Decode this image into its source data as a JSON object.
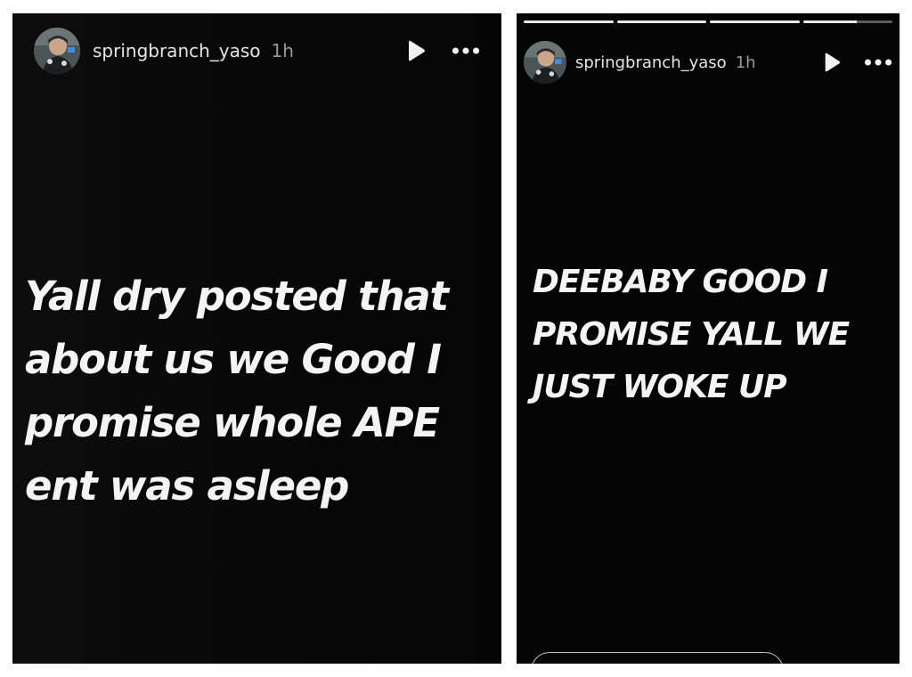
{
  "stories": [
    {
      "username": "springbranch_yaso",
      "time": "1h",
      "text": "Yall dry posted that\nabout us we Good I\npromise whole APE\nent was asleep",
      "avatar_icon": "profile-avatar",
      "play_icon": "play-icon",
      "more_icon": "more-options-icon"
    },
    {
      "username": "springbranch_yaso",
      "time": "1h",
      "text": "DEEBABY GOOD I\nPROMISE YALL WE\nJUST WOKE UP",
      "avatar_icon": "profile-avatar",
      "play_icon": "play-icon",
      "more_icon": "more-options-icon",
      "progress": [
        1,
        1,
        1,
        0.6
      ]
    }
  ],
  "colors": {
    "background": "#050505",
    "text": "#f4f4f4",
    "secondary_text": "#9a9a9a",
    "page": "#ffffff"
  }
}
